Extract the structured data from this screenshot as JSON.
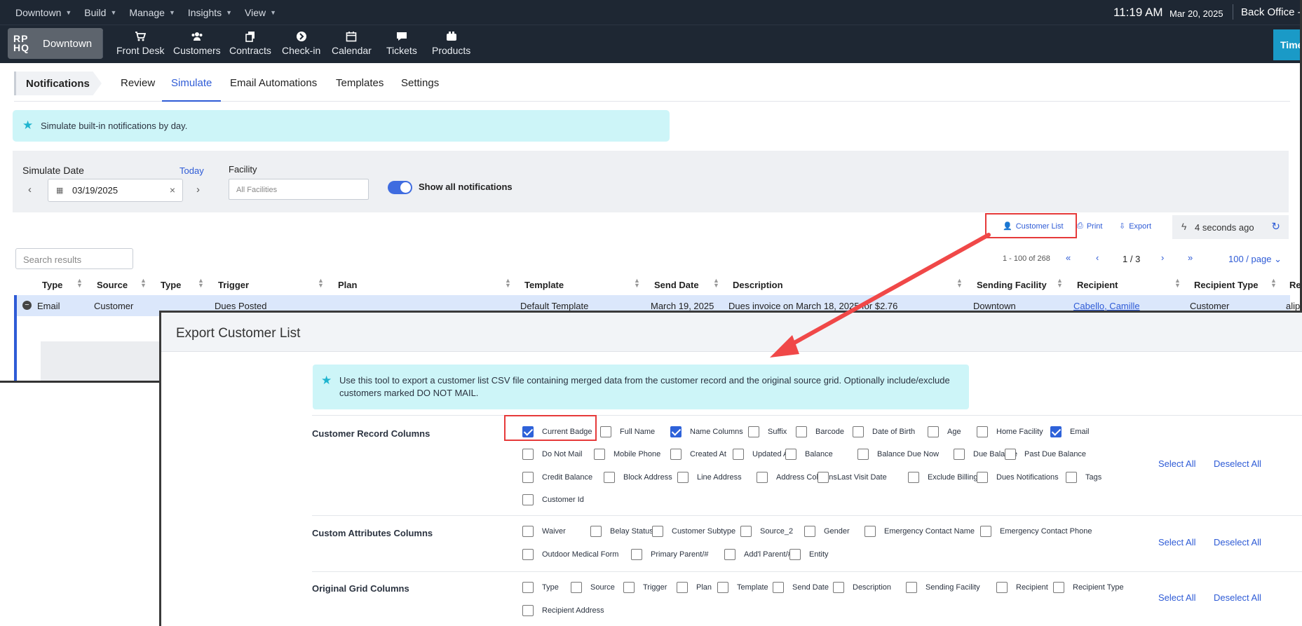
{
  "menubar": {
    "items": [
      "Downtown",
      "Build",
      "Manage",
      "Insights",
      "View"
    ],
    "time": "11:19 AM",
    "date": "Mar 20, 2025",
    "location": "Back Office -"
  },
  "toolbar": {
    "brand_logo_top": "RP",
    "brand_logo_bottom": "HQ",
    "brand_name": "Downtown",
    "items": [
      {
        "label": "Front Desk",
        "icon": "cart-icon"
      },
      {
        "label": "Customers",
        "icon": "users-icon"
      },
      {
        "label": "Contracts",
        "icon": "documents-icon"
      },
      {
        "label": "Check-in",
        "icon": "arrow-circle-icon"
      },
      {
        "label": "Calendar",
        "icon": "calendar-icon"
      },
      {
        "label": "Tickets",
        "icon": "chat-icon"
      },
      {
        "label": "Products",
        "icon": "products-icon"
      }
    ],
    "timeclock": "Time"
  },
  "tabs": {
    "title": "Notifications",
    "items": [
      "Review",
      "Simulate",
      "Email Automations",
      "Templates",
      "Settings"
    ],
    "active": "Simulate"
  },
  "banner": {
    "text": "Simulate built-in notifications by day."
  },
  "filters": {
    "simulate_date_label": "Simulate Date",
    "today_link": "Today",
    "date_value": "03/19/2025",
    "facility_label": "Facility",
    "facility_placeholder": "All Facilities",
    "toggle_label": "Show all notifications",
    "toggle_on": true
  },
  "actions": {
    "customer_list": "Customer List",
    "print": "Print",
    "export": "Export",
    "refreshed": "4 seconds ago"
  },
  "grid": {
    "search_placeholder": "Search results",
    "range": "1 - 100 of 268",
    "page": "1 / 3",
    "per_page": "100 / page",
    "columns": [
      "Type",
      "Source",
      "Type",
      "Trigger",
      "Plan",
      "Template",
      "Send Date",
      "Description",
      "Sending Facility",
      "Recipient",
      "Recipient Type",
      "Re"
    ],
    "row": {
      "type": "Email",
      "source": "Customer",
      "trigger": "Dues Posted",
      "template": "Default Template",
      "send_date": "March 19, 2025",
      "description": "Dues invoice on March 18, 2025 for $2.76",
      "sending_facility": "Downtown",
      "recipient": "Cabello, Camille",
      "recipient_type": "Customer",
      "extra": "alip"
    }
  },
  "modal": {
    "title": "Export Customer List",
    "info": "Use this tool to export a customer list CSV file containing merged data from the customer record and the original source grid. Optionally include/exclude customers marked DO NOT MAIL.",
    "select_all": "Select All",
    "deselect_all": "Deselect All",
    "sections": [
      {
        "title": "Customer Record Columns",
        "columns": [
          {
            "label": "Current Badge",
            "checked": true
          },
          {
            "label": "Full Name",
            "checked": false
          },
          {
            "label": "Name Columns",
            "checked": true
          },
          {
            "label": "Suffix",
            "checked": false
          },
          {
            "label": "Barcode",
            "checked": false
          },
          {
            "label": "Date of Birth",
            "checked": false
          },
          {
            "label": "Age",
            "checked": false
          },
          {
            "label": "Home Facility",
            "checked": false
          },
          {
            "label": "Email",
            "checked": true
          },
          {
            "label": "Do Not Mail",
            "checked": false
          },
          {
            "label": "Mobile Phone",
            "checked": false
          },
          {
            "label": "Created At",
            "checked": false
          },
          {
            "label": "Updated At",
            "checked": false
          },
          {
            "label": "Balance",
            "checked": false
          },
          {
            "label": "Balance Due Now",
            "checked": false
          },
          {
            "label": "Due Balance",
            "checked": false
          },
          {
            "label": "Past Due Balance",
            "checked": false
          },
          {
            "label": "Credit Balance",
            "checked": false
          },
          {
            "label": "Block Address",
            "checked": false
          },
          {
            "label": "Line Address",
            "checked": false
          },
          {
            "label": "Address Columns",
            "checked": false
          },
          {
            "label": "Last Visit Date",
            "checked": false
          },
          {
            "label": "Exclude Billing",
            "checked": false
          },
          {
            "label": "Dues Notifications",
            "checked": false
          },
          {
            "label": "Tags",
            "checked": false
          },
          {
            "label": "Customer Id",
            "checked": false
          }
        ]
      },
      {
        "title": "Custom Attributes Columns",
        "columns": [
          {
            "label": "Waiver",
            "checked": false
          },
          {
            "label": "Belay Status",
            "checked": false
          },
          {
            "label": "Customer Subtype",
            "checked": false
          },
          {
            "label": "Source_2",
            "checked": false
          },
          {
            "label": "Gender",
            "checked": false
          },
          {
            "label": "Emergency Contact Name",
            "checked": false
          },
          {
            "label": "Emergency Contact Phone",
            "checked": false
          },
          {
            "label": "Outdoor Medical Form",
            "checked": false
          },
          {
            "label": "Primary Parent/#",
            "checked": false
          },
          {
            "label": "Add'l Parent/#",
            "checked": false
          },
          {
            "label": "Entity",
            "checked": false
          }
        ]
      },
      {
        "title": "Original Grid Columns",
        "columns": [
          {
            "label": "Type",
            "checked": false
          },
          {
            "label": "Source",
            "checked": false
          },
          {
            "label": "Trigger",
            "checked": false
          },
          {
            "label": "Plan",
            "checked": false
          },
          {
            "label": "Template",
            "checked": false
          },
          {
            "label": "Send Date",
            "checked": false
          },
          {
            "label": "Description",
            "checked": false
          },
          {
            "label": "Sending Facility",
            "checked": false
          },
          {
            "label": "Recipient",
            "checked": false
          },
          {
            "label": "Recipient Type",
            "checked": false
          },
          {
            "label": "Recipient Address",
            "checked": false
          }
        ]
      }
    ]
  },
  "annotations": {
    "highlight_color": "#e63a3a",
    "arrow_color": "#f04848"
  }
}
